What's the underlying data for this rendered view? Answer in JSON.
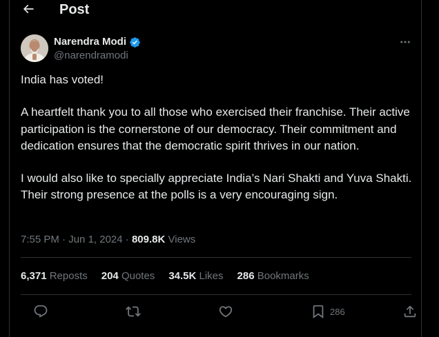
{
  "header": {
    "title": "Post",
    "back_icon": "arrow-left-icon"
  },
  "author": {
    "name": "Narendra Modi",
    "handle": "@narendramodi",
    "verified_icon": "verified-badge-icon",
    "verified_color": "#1d9bf0"
  },
  "tweet": {
    "paragraphs": [
      "India has voted!",
      "A heartfelt thank you to all those who exercised their franchise. Their active participation is the cornerstone of our democracy. Their commitment and dedication ensures that the democratic spirit thrives in our nation.",
      "I would also like to specially appreciate India’s Nari Shakti and Yuva Shakti. Their strong presence at the polls is a very encouraging sign."
    ]
  },
  "meta": {
    "time": "7:55 PM",
    "separator": " · ",
    "date": "Jun 1, 2024",
    "views_count": "809.8K",
    "views_label": " Views"
  },
  "stats": {
    "reposts": {
      "count": "6,371",
      "label": " Reposts"
    },
    "quotes": {
      "count": "204",
      "label": " Quotes"
    },
    "likes": {
      "count": "34.5K",
      "label": " Likes"
    },
    "bookmarks": {
      "count": "286",
      "label": " Bookmarks"
    }
  },
  "actions": {
    "reply_icon": "reply-icon",
    "repost_icon": "repost-icon",
    "like_icon": "heart-icon",
    "bookmark_icon": "bookmark-icon",
    "bookmark_count": "286",
    "share_icon": "share-icon"
  },
  "colors": {
    "background": "#000000",
    "text": "#e7e9ea",
    "secondary_text": "#71767b",
    "border": "#2f3336"
  }
}
